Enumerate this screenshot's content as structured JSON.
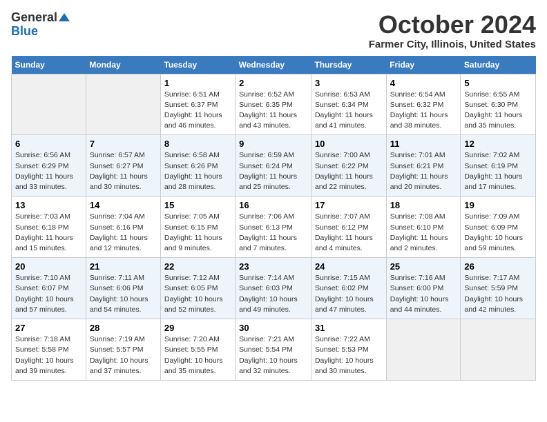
{
  "logo": {
    "general": "General",
    "blue": "Blue"
  },
  "title": {
    "month": "October 2024",
    "location": "Farmer City, Illinois, United States"
  },
  "weekdays": [
    "Sunday",
    "Monday",
    "Tuesday",
    "Wednesday",
    "Thursday",
    "Friday",
    "Saturday"
  ],
  "weeks": [
    [
      {
        "day": null
      },
      {
        "day": null
      },
      {
        "day": "1",
        "sunrise": "Sunrise: 6:51 AM",
        "sunset": "Sunset: 6:37 PM",
        "daylight": "Daylight: 11 hours and 46 minutes."
      },
      {
        "day": "2",
        "sunrise": "Sunrise: 6:52 AM",
        "sunset": "Sunset: 6:35 PM",
        "daylight": "Daylight: 11 hours and 43 minutes."
      },
      {
        "day": "3",
        "sunrise": "Sunrise: 6:53 AM",
        "sunset": "Sunset: 6:34 PM",
        "daylight": "Daylight: 11 hours and 41 minutes."
      },
      {
        "day": "4",
        "sunrise": "Sunrise: 6:54 AM",
        "sunset": "Sunset: 6:32 PM",
        "daylight": "Daylight: 11 hours and 38 minutes."
      },
      {
        "day": "5",
        "sunrise": "Sunrise: 6:55 AM",
        "sunset": "Sunset: 6:30 PM",
        "daylight": "Daylight: 11 hours and 35 minutes."
      }
    ],
    [
      {
        "day": "6",
        "sunrise": "Sunrise: 6:56 AM",
        "sunset": "Sunset: 6:29 PM",
        "daylight": "Daylight: 11 hours and 33 minutes."
      },
      {
        "day": "7",
        "sunrise": "Sunrise: 6:57 AM",
        "sunset": "Sunset: 6:27 PM",
        "daylight": "Daylight: 11 hours and 30 minutes."
      },
      {
        "day": "8",
        "sunrise": "Sunrise: 6:58 AM",
        "sunset": "Sunset: 6:26 PM",
        "daylight": "Daylight: 11 hours and 28 minutes."
      },
      {
        "day": "9",
        "sunrise": "Sunrise: 6:59 AM",
        "sunset": "Sunset: 6:24 PM",
        "daylight": "Daylight: 11 hours and 25 minutes."
      },
      {
        "day": "10",
        "sunrise": "Sunrise: 7:00 AM",
        "sunset": "Sunset: 6:22 PM",
        "daylight": "Daylight: 11 hours and 22 minutes."
      },
      {
        "day": "11",
        "sunrise": "Sunrise: 7:01 AM",
        "sunset": "Sunset: 6:21 PM",
        "daylight": "Daylight: 11 hours and 20 minutes."
      },
      {
        "day": "12",
        "sunrise": "Sunrise: 7:02 AM",
        "sunset": "Sunset: 6:19 PM",
        "daylight": "Daylight: 11 hours and 17 minutes."
      }
    ],
    [
      {
        "day": "13",
        "sunrise": "Sunrise: 7:03 AM",
        "sunset": "Sunset: 6:18 PM",
        "daylight": "Daylight: 11 hours and 15 minutes."
      },
      {
        "day": "14",
        "sunrise": "Sunrise: 7:04 AM",
        "sunset": "Sunset: 6:16 PM",
        "daylight": "Daylight: 11 hours and 12 minutes."
      },
      {
        "day": "15",
        "sunrise": "Sunrise: 7:05 AM",
        "sunset": "Sunset: 6:15 PM",
        "daylight": "Daylight: 11 hours and 9 minutes."
      },
      {
        "day": "16",
        "sunrise": "Sunrise: 7:06 AM",
        "sunset": "Sunset: 6:13 PM",
        "daylight": "Daylight: 11 hours and 7 minutes."
      },
      {
        "day": "17",
        "sunrise": "Sunrise: 7:07 AM",
        "sunset": "Sunset: 6:12 PM",
        "daylight": "Daylight: 11 hours and 4 minutes."
      },
      {
        "day": "18",
        "sunrise": "Sunrise: 7:08 AM",
        "sunset": "Sunset: 6:10 PM",
        "daylight": "Daylight: 11 hours and 2 minutes."
      },
      {
        "day": "19",
        "sunrise": "Sunrise: 7:09 AM",
        "sunset": "Sunset: 6:09 PM",
        "daylight": "Daylight: 10 hours and 59 minutes."
      }
    ],
    [
      {
        "day": "20",
        "sunrise": "Sunrise: 7:10 AM",
        "sunset": "Sunset: 6:07 PM",
        "daylight": "Daylight: 10 hours and 57 minutes."
      },
      {
        "day": "21",
        "sunrise": "Sunrise: 7:11 AM",
        "sunset": "Sunset: 6:06 PM",
        "daylight": "Daylight: 10 hours and 54 minutes."
      },
      {
        "day": "22",
        "sunrise": "Sunrise: 7:12 AM",
        "sunset": "Sunset: 6:05 PM",
        "daylight": "Daylight: 10 hours and 52 minutes."
      },
      {
        "day": "23",
        "sunrise": "Sunrise: 7:14 AM",
        "sunset": "Sunset: 6:03 PM",
        "daylight": "Daylight: 10 hours and 49 minutes."
      },
      {
        "day": "24",
        "sunrise": "Sunrise: 7:15 AM",
        "sunset": "Sunset: 6:02 PM",
        "daylight": "Daylight: 10 hours and 47 minutes."
      },
      {
        "day": "25",
        "sunrise": "Sunrise: 7:16 AM",
        "sunset": "Sunset: 6:00 PM",
        "daylight": "Daylight: 10 hours and 44 minutes."
      },
      {
        "day": "26",
        "sunrise": "Sunrise: 7:17 AM",
        "sunset": "Sunset: 5:59 PM",
        "daylight": "Daylight: 10 hours and 42 minutes."
      }
    ],
    [
      {
        "day": "27",
        "sunrise": "Sunrise: 7:18 AM",
        "sunset": "Sunset: 5:58 PM",
        "daylight": "Daylight: 10 hours and 39 minutes."
      },
      {
        "day": "28",
        "sunrise": "Sunrise: 7:19 AM",
        "sunset": "Sunset: 5:57 PM",
        "daylight": "Daylight: 10 hours and 37 minutes."
      },
      {
        "day": "29",
        "sunrise": "Sunrise: 7:20 AM",
        "sunset": "Sunset: 5:55 PM",
        "daylight": "Daylight: 10 hours and 35 minutes."
      },
      {
        "day": "30",
        "sunrise": "Sunrise: 7:21 AM",
        "sunset": "Sunset: 5:54 PM",
        "daylight": "Daylight: 10 hours and 32 minutes."
      },
      {
        "day": "31",
        "sunrise": "Sunrise: 7:22 AM",
        "sunset": "Sunset: 5:53 PM",
        "daylight": "Daylight: 10 hours and 30 minutes."
      },
      {
        "day": null
      },
      {
        "day": null
      }
    ]
  ]
}
